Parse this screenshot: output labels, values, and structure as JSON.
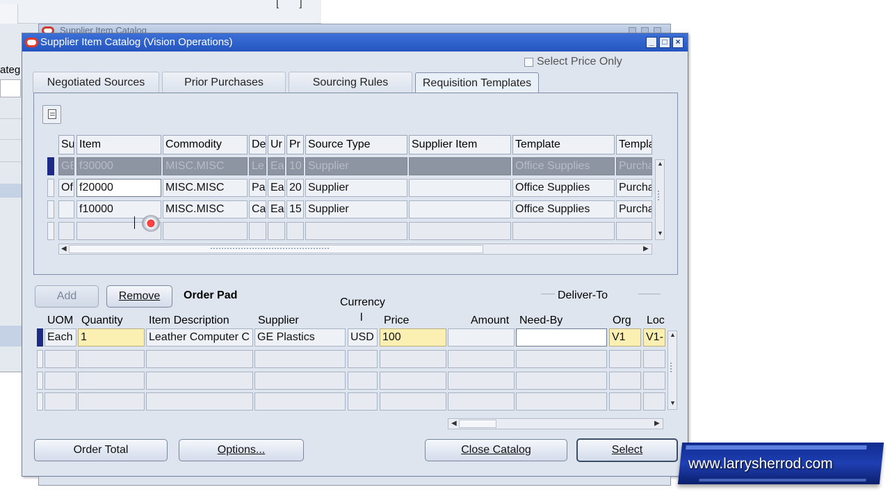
{
  "background": {
    "left_window_label": "ateg",
    "mid_window_title": "Supplier Item Catalog"
  },
  "window": {
    "title": "Supplier Item Catalog (Vision Operations)",
    "select_price_only": "Select Price Only"
  },
  "tabs": [
    {
      "label": "Negotiated Sources"
    },
    {
      "label": "Prior Purchases"
    },
    {
      "label": "Sourcing Rules"
    },
    {
      "label": "Requisition Templates",
      "active": true
    }
  ],
  "templates_grid": {
    "headers": [
      "Su",
      "Item",
      "Commodity",
      "De",
      "Ur",
      "Pr",
      "Source Type",
      "Supplier Item",
      "Template",
      "Templa"
    ],
    "rows": [
      [
        "GE",
        "f30000",
        "MISC.MISC",
        "Le",
        "Ea",
        "10",
        "Supplier",
        "",
        "Office Supplies",
        "Purcha"
      ],
      [
        "Of",
        "f20000",
        "MISC.MISC",
        "Pa",
        "Ea",
        "20",
        "Supplier",
        "",
        "Office Supplies",
        "Purcha"
      ],
      [
        "",
        "f10000",
        "MISC.MISC",
        "Ca",
        "Ea",
        "15",
        "Supplier",
        "",
        "Office Supplies",
        "Purcha"
      ],
      [
        "",
        "",
        "",
        "",
        "",
        "",
        "",
        "",
        "",
        ""
      ]
    ]
  },
  "order_pad": {
    "add_label": "Add",
    "remove_label": "Remove",
    "title": "Order Pad",
    "deliver_to_label": "Deliver-To",
    "currency_label": "Currency",
    "currency_sub": "l",
    "headers": [
      "UOM",
      "Quantity",
      "Item Description",
      "Supplier",
      "",
      "Price",
      "Amount",
      "Need-By",
      "Org",
      "Loc"
    ],
    "rows": [
      [
        "Each",
        "1",
        "Leather Computer C",
        "GE Plastics",
        "USD",
        "100",
        "",
        "",
        "V1",
        "V1-"
      ],
      [
        "",
        "",
        "",
        "",
        "",
        "",
        "",
        "",
        "",
        ""
      ],
      [
        "",
        "",
        "",
        "",
        "",
        "",
        "",
        "",
        "",
        ""
      ],
      [
        "",
        "",
        "",
        "",
        "",
        "",
        "",
        "",
        "",
        ""
      ]
    ]
  },
  "buttons": {
    "order_total": "Order Total",
    "options": "Options...",
    "close_catalog": "Close Catalog",
    "select": "Select"
  },
  "watermark": "www.larrysherrod.com",
  "colors": {
    "titlebar": "#2f63cf",
    "selected_row": "#8d95a3",
    "required_field": "#fbf0b2",
    "banner": "#1f3fb3"
  }
}
